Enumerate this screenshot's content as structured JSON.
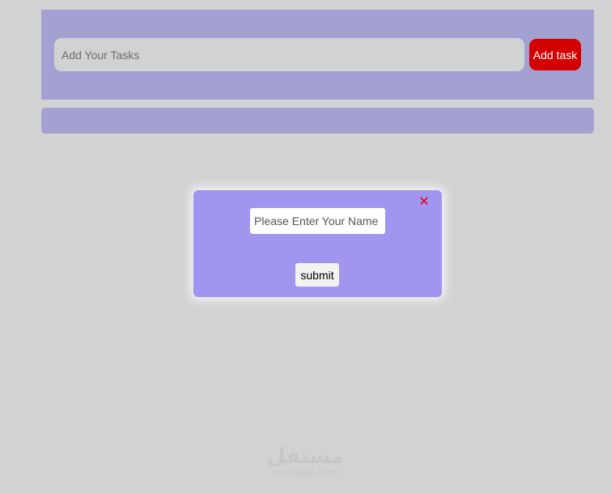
{
  "task_form": {
    "input_placeholder": "Add Your Tasks",
    "input_value": "",
    "add_button_label": "Add task"
  },
  "tasks": [],
  "name_modal": {
    "close_icon": "close-icon",
    "close_glyph": "✕",
    "name_placeholder": "Please Enter Your Name",
    "name_value": "",
    "submit_label": "submit"
  },
  "watermark": {
    "logo_text": "مستقل",
    "url_text": "mostaql.com"
  },
  "colors": {
    "page_background": "#d1d3d3",
    "panel_background": "#a3a1d2",
    "add_button": "#d40000",
    "modal_background": "#a095ef",
    "close_icon": "#e00018"
  }
}
